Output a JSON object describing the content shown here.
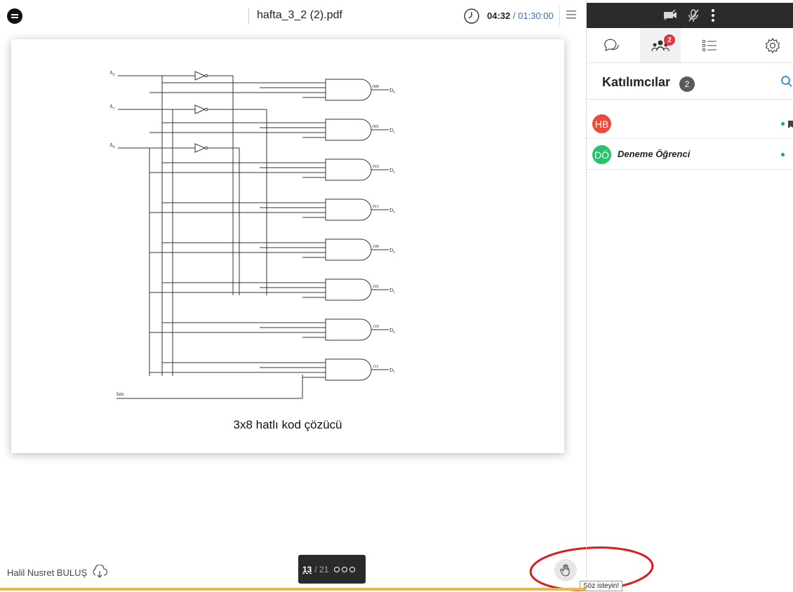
{
  "app": {
    "logo_icon": "chat-bubble-logo",
    "document_title": "hafta_3_2 (2).pdf"
  },
  "timer": {
    "elapsed": "04:32",
    "separator": " / ",
    "total": "01:30:00"
  },
  "slide": {
    "caption": "3x8 hatlı kod çözücü",
    "diagram": {
      "inputs": [
        "A2",
        "A1",
        "A0",
        "Isin"
      ],
      "gate_codes": [
        "000",
        "001",
        "010",
        "011",
        "100",
        "101",
        "110",
        "111"
      ],
      "outputs": [
        "D0",
        "D1",
        "D2",
        "D3",
        "D4",
        "D5",
        "D6",
        "D7"
      ]
    }
  },
  "bottom": {
    "presenter_name": "Halil Nusret BULUŞ",
    "page_current": "13",
    "page_total": "/ 21",
    "raise_hand_tooltip": "Söz isteyin!"
  },
  "side_panel": {
    "tabs": [
      {
        "icon": "chat-icon"
      },
      {
        "icon": "participants-icon",
        "badge": "2"
      },
      {
        "icon": "list-icon"
      },
      {
        "icon": "settings-icon"
      }
    ],
    "participants_title": "Katılımcılar",
    "participants_count": "2",
    "participants": [
      {
        "initials": "HB",
        "name": "",
        "color": "#e74c3c"
      },
      {
        "initials": "DÖ",
        "name": "Deneme Öğrenci",
        "color": "#27c26c"
      }
    ]
  },
  "colors": {
    "accent_bar": "#e8b94a",
    "media_bar": "#2b2b2b",
    "online": "#1faa5b",
    "link_blue": "#3a6fb0"
  }
}
